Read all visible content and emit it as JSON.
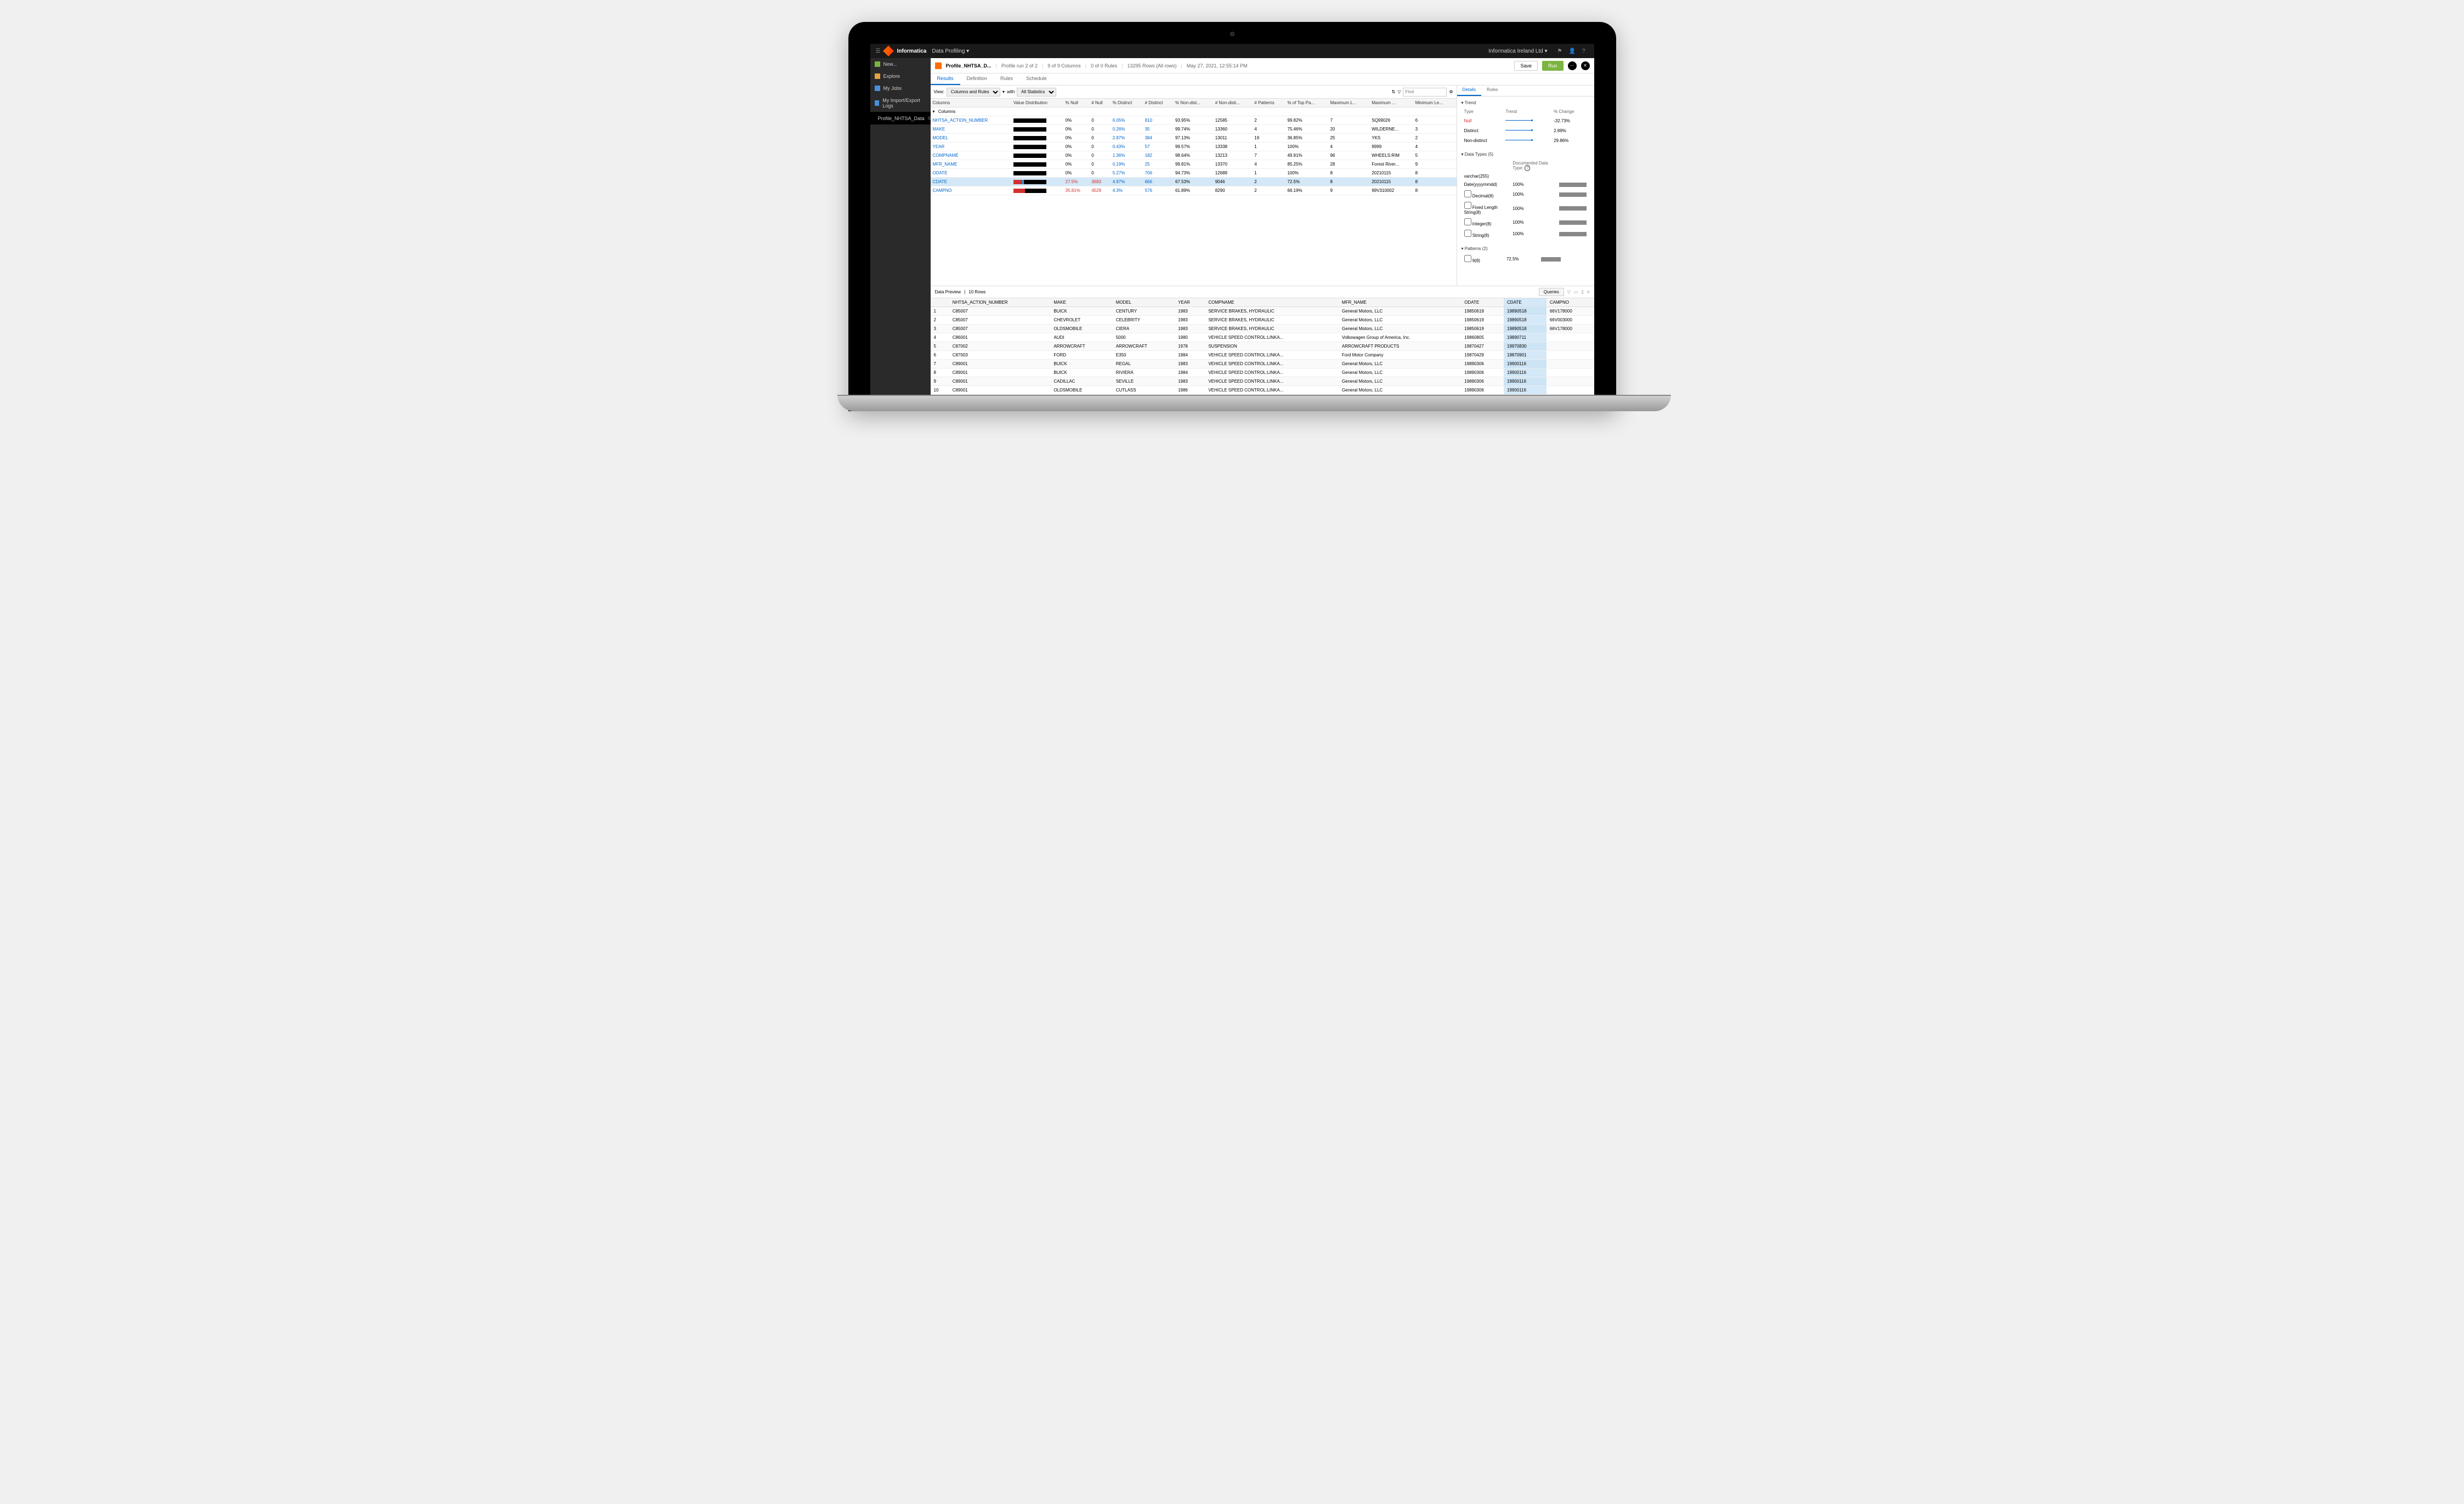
{
  "topbar": {
    "brand": "Informatica",
    "module": "Data Profiling",
    "org": "Informatica Ireland Ltd"
  },
  "sidebar": {
    "items": [
      {
        "label": "New...",
        "icon": "ic-new"
      },
      {
        "label": "Explore",
        "icon": "ic-explore"
      },
      {
        "label": "My Jobs",
        "icon": "ic-jobs"
      },
      {
        "label": "My Import/Export Logs",
        "icon": "ic-log"
      },
      {
        "label": "Profile_NHTSA_Data",
        "icon": "ic-profile",
        "active": true
      }
    ]
  },
  "header": {
    "title": "Profile_NHTSA_D...",
    "run": "Profile run 2 of 2",
    "cols": "9 of 9 Columns",
    "rules": "0 of 0 Rules",
    "rows": "13295 Rows (All rows)",
    "time": "May 27, 2021, 12:55:14 PM",
    "save": "Save",
    "runBtn": "Run"
  },
  "tabs": [
    "Results",
    "Definition",
    "Rules",
    "Schedule"
  ],
  "toolbar": {
    "viewLabel": "View:",
    "view": "Columns and Rules",
    "withLabel": "with",
    "stats": "All Statistics",
    "find": "Find"
  },
  "gridHeaders": [
    "Columns",
    "Value Distribution",
    "% Null",
    "# Null",
    "% Distinct",
    "# Distinct",
    "% Non-dist...",
    "# Non-disti...",
    "# Patterns",
    "% of Top Pa...",
    "Maximum L...",
    "Maximum ...",
    "Minimum Le..."
  ],
  "gridGroup": "Columns",
  "gridRows": [
    {
      "name": "NHTSA_ACTION_NUMBER",
      "r": 0,
      "pNull": "0%",
      "nNull": "0",
      "pDist": "6.05%",
      "nDist": "810",
      "pNon": "93.95%",
      "nNon": "12585",
      "pat": "2",
      "top": "99.82%",
      "maxL": "7",
      "max": "SQ99026",
      "minL": "6"
    },
    {
      "name": "MAKE",
      "r": 0,
      "pNull": "0%",
      "nNull": "0",
      "pDist": "0.26%",
      "nDist": "35",
      "pNon": "99.74%",
      "nNon": "13360",
      "pat": "4",
      "top": "75.46%",
      "maxL": "20",
      "max": "WILDERNE...",
      "minL": "3"
    },
    {
      "name": "MODEL",
      "r": 0,
      "pNull": "0%",
      "nNull": "0",
      "pDist": "2.87%",
      "nDist": "384",
      "pNon": "97.13%",
      "nNon": "13011",
      "pat": "19",
      "top": "36.85%",
      "maxL": "25",
      "max": "YKS",
      "minL": "2"
    },
    {
      "name": "YEAR",
      "r": 0,
      "pNull": "0%",
      "nNull": "0",
      "pDist": "0.43%",
      "nDist": "57",
      "pNon": "99.57%",
      "nNon": "13338",
      "pat": "1",
      "top": "100%",
      "maxL": "4",
      "max": "9999",
      "minL": "4"
    },
    {
      "name": "COMPNAME",
      "r": 0,
      "pNull": "0%",
      "nNull": "0",
      "pDist": "1.36%",
      "nDist": "182",
      "pNon": "98.64%",
      "nNon": "13213",
      "pat": "7",
      "top": "49.91%",
      "maxL": "96",
      "max": "WHEELS:RIM",
      "minL": "5"
    },
    {
      "name": "MFR_NAME",
      "r": 0,
      "pNull": "0%",
      "nNull": "0",
      "pDist": "0.19%",
      "nDist": "25",
      "pNon": "99.81%",
      "nNon": "13370",
      "pat": "4",
      "top": "85.25%",
      "maxL": "28",
      "max": "Forest River...",
      "minL": "9"
    },
    {
      "name": "ODATE",
      "r": 0,
      "pNull": "0%",
      "nNull": "0",
      "pDist": "5.27%",
      "nDist": "706",
      "pNon": "94.73%",
      "nNon": "12689",
      "pat": "1",
      "top": "100%",
      "maxL": "8",
      "max": "20210115",
      "minL": "8"
    },
    {
      "name": "CDATE",
      "r": 27.5,
      "b": 5,
      "pNull": "27.5%",
      "nNull": "3683",
      "pDist": "4.97%",
      "nDist": "666",
      "pNon": "67.53%",
      "nNon": "9046",
      "pat": "2",
      "top": "72.5%",
      "maxL": "8",
      "max": "20210115",
      "minL": "8",
      "sel": true
    },
    {
      "name": "CAMPNO",
      "r": 35.81,
      "pNull": "35.81%",
      "nNull": "4529",
      "pDist": "4.3%",
      "nDist": "576",
      "pNon": "61.89%",
      "nNon": "8290",
      "pat": "2",
      "top": "66.19%",
      "maxL": "9",
      "max": "99V310002",
      "minL": "8"
    }
  ],
  "details": {
    "tabs": [
      "Details",
      "Rules"
    ],
    "trend": {
      "title": "Trend",
      "headers": [
        "Type",
        "Trend",
        "% Change"
      ],
      "rows": [
        {
          "type": "Null",
          "change": "-32.73%",
          "red": true
        },
        {
          "type": "Distinct",
          "change": "2.89%"
        },
        {
          "type": "Non-distinct",
          "change": "29.86%"
        }
      ]
    },
    "dataTypesTitle": "Data Types (5)",
    "docLabel": "Documented Data Type:",
    "dataTypes": [
      {
        "name": "varchar(255)",
        "pct": "",
        "bar": 0,
        "check": false
      },
      {
        "name": "Date(yyyymmdd)",
        "pct": "100%",
        "bar": 100,
        "check": false
      },
      {
        "name": "Decimal(8)",
        "pct": "100%",
        "bar": 100,
        "check": true
      },
      {
        "name": "Fixed Length String(8)",
        "pct": "100%",
        "bar": 100,
        "check": true
      },
      {
        "name": "Integer(8)",
        "pct": "100%",
        "bar": 100,
        "check": true
      },
      {
        "name": "String(8)",
        "pct": "100%",
        "bar": 100,
        "check": true
      }
    ],
    "patternsTitle": "Patterns (2)",
    "patterns": [
      {
        "name": "9(8)",
        "pct": "72.5%",
        "bar": 72
      }
    ]
  },
  "preview": {
    "title": "Data Preview",
    "rowcount": "10 Rows",
    "queries": "Queries",
    "headers": [
      "",
      "NHTSA_ACTION_NUMBER",
      "MAKE",
      "MODEL",
      "YEAR",
      "COMPNAME",
      "MFR_NAME",
      "ODATE",
      "CDATE",
      "CAMPNO"
    ],
    "hlCol": 8,
    "rows": [
      [
        "1",
        "C85007",
        "BUICK",
        "CENTURY",
        "1983",
        "SERVICE BRAKES, HYDRAULIC",
        "General Motors, LLC",
        "19850619",
        "19890518",
        "66V178000"
      ],
      [
        "2",
        "C85007",
        "CHEVROLET",
        "CELEBRITY",
        "1983",
        "SERVICE BRAKES, HYDRAULIC",
        "General Motors, LLC",
        "19850619",
        "19890518",
        "66V003000"
      ],
      [
        "3",
        "C85007",
        "OLDSMOBILE",
        "CIERA",
        "1983",
        "SERVICE BRAKES, HYDRAULIC",
        "General Motors, LLC",
        "19850619",
        "19890518",
        "66V178000"
      ],
      [
        "4",
        "C86001",
        "AUDI",
        "5000",
        "1980",
        "VEHICLE SPEED CONTROL:LINKA...",
        "Volkswagen Group of America, Inc.",
        "19860805",
        "19890711",
        ""
      ],
      [
        "5",
        "C87002",
        "ARROWCRAFT",
        "ARROWCRAFT",
        "1978",
        "SUSPENSION",
        "ARROWCRAFT PRODUCTS",
        "19870427",
        "19970830",
        ""
      ],
      [
        "6",
        "C87003",
        "FORD",
        "E350",
        "1984",
        "VEHICLE SPEED CONTROL:LINKA...",
        "Ford Motor Company",
        "19870429",
        "19870901",
        ""
      ],
      [
        "7",
        "C89001",
        "BUICK",
        "REGAL",
        "1983",
        "VEHICLE SPEED CONTROL:LINKA...",
        "General Motors, LLC",
        "19890306",
        "19900116",
        ""
      ],
      [
        "8",
        "C89001",
        "BUICK",
        "RIVIERA",
        "1984",
        "VEHICLE SPEED CONTROL:LINKA...",
        "General Motors, LLC",
        "19890306",
        "19900116",
        ""
      ],
      [
        "9",
        "C89001",
        "CADILLAC",
        "SEVILLE",
        "1983",
        "VEHICLE SPEED CONTROL:LINKA...",
        "General Motors, LLC",
        "19890306",
        "19900116",
        ""
      ],
      [
        "10",
        "C89001",
        "OLDSMOBILE",
        "CUTLASS",
        "1986",
        "VEHICLE SPEED CONTROL:LINKA...",
        "General Motors, LLC",
        "19890306",
        "19900116",
        ""
      ]
    ]
  }
}
